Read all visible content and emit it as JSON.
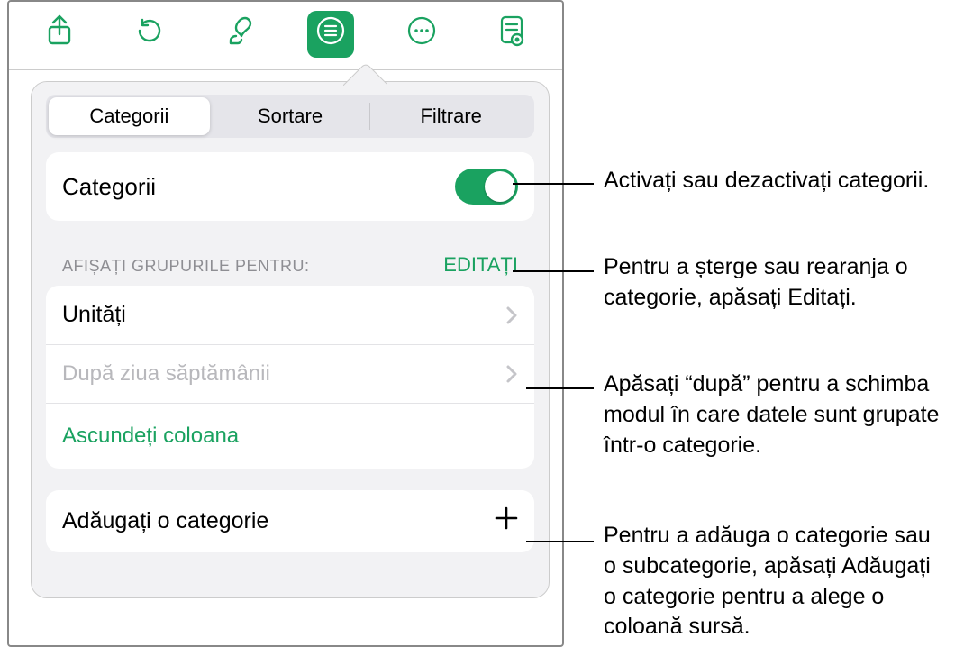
{
  "toolbar": {
    "share_icon": "share",
    "undo_icon": "undo",
    "paint_icon": "paintbrush",
    "organize_icon": "list.bullet.circle",
    "more_icon": "ellipsis.circle",
    "preview_icon": "doc.text"
  },
  "segmented": {
    "categories": "Categorii",
    "sort": "Sortare",
    "filter": "Filtrare"
  },
  "categories_toggle_label": "Categorii",
  "section_header": {
    "label": "AFIȘAȚI GRUPURILE PENTRU:",
    "edit": "EDITAȚI"
  },
  "rows": {
    "item_0": "Unități",
    "item_1": "După ziua săptămânii",
    "hide_column": "Ascundeți coloana",
    "add_category": "Adăugați o categorie"
  },
  "callouts": {
    "c1": "Activați sau dezactivați categorii.",
    "c2": "Pentru a șterge sau rearanja o categorie, apăsați Editați.",
    "c3": "Apăsați “după” pentru a schimba modul în care datele sunt grupate într-o categorie.",
    "c4": "Pentru a adăuga o categorie sau o subcategorie, apăsați Adăugați o categorie pentru a alege o coloană sursă."
  }
}
